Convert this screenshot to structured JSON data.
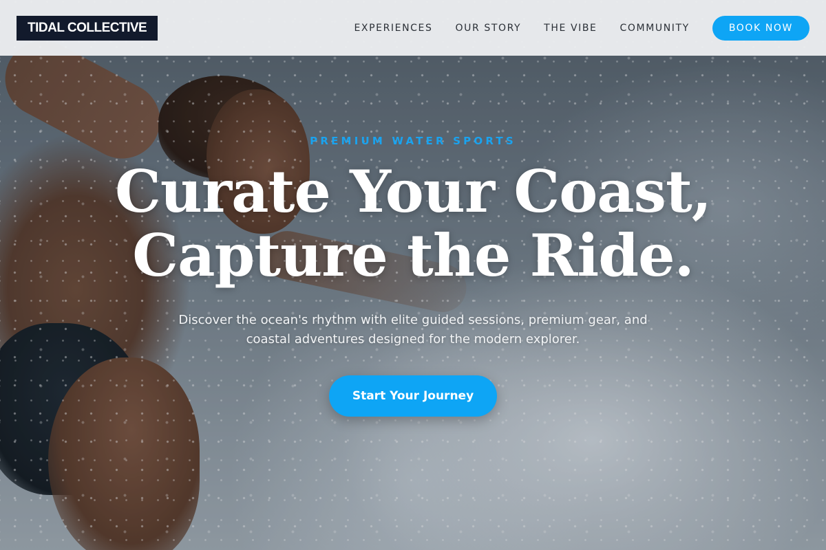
{
  "nav": {
    "logo": "TIDAL COLLECTIVE",
    "items": [
      {
        "label": "EXPERIENCES"
      },
      {
        "label": "OUR STORY"
      },
      {
        "label": "THE VIBE"
      },
      {
        "label": "COMMUNITY"
      }
    ],
    "cta_label": "BOOK NOW"
  },
  "hero": {
    "eyebrow": "PREMIUM WATER SPORTS",
    "headline_line1": "Curate Your Coast,",
    "headline_line2": "Capture the Ride.",
    "subtext": "Discover the ocean's rhythm with elite guided sessions, premium gear, and coastal adventures designed for the modern explorer.",
    "cta_label": "Start Your Journey"
  },
  "colors": {
    "accent": "#0ea5f5",
    "logo_bg": "#121a2c",
    "nav_bg": "#eceef0"
  }
}
